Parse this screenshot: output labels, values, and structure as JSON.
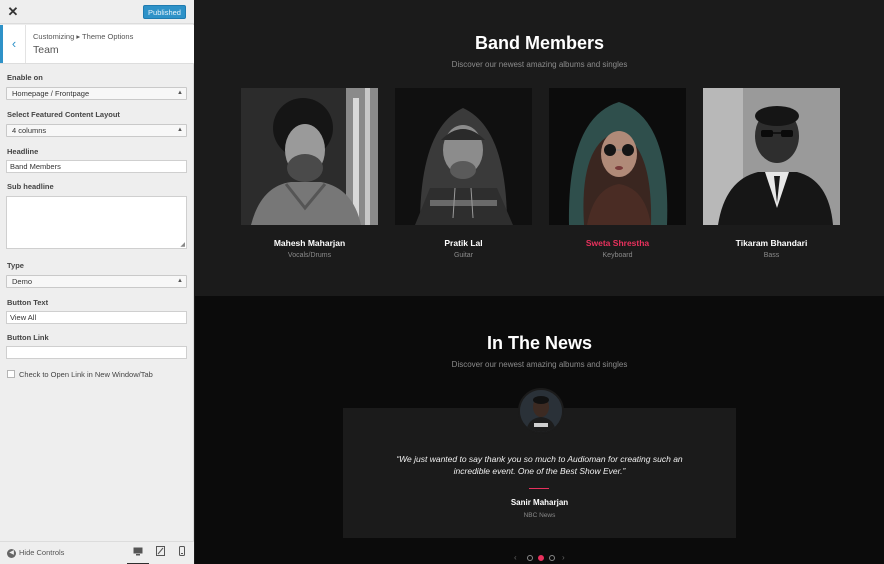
{
  "topbar": {
    "close_label": "✕",
    "published_label": "Published"
  },
  "section": {
    "breadcrumb": "Customizing ▸ Theme Options",
    "title": "Team",
    "back_glyph": "‹"
  },
  "controls": {
    "enable_on": {
      "label": "Enable on",
      "value": "Homepage / Frontpage"
    },
    "layout": {
      "label": "Select Featured Content Layout",
      "value": "4 columns"
    },
    "headline": {
      "label": "Headline",
      "value": "Band Members"
    },
    "subheadline": {
      "label": "Sub headline",
      "value": ""
    },
    "type": {
      "label": "Type",
      "value": "Demo"
    },
    "button_text": {
      "label": "Button Text",
      "value": "View All"
    },
    "button_link": {
      "label": "Button Link",
      "value": ""
    },
    "new_tab": {
      "label": "Check to Open Link in New Window/Tab",
      "checked": false
    }
  },
  "bottombar": {
    "hide_controls": "Hide Controls"
  },
  "band": {
    "title": "Band Members",
    "subtitle": "Discover our newest amazing albums and singles",
    "members": [
      {
        "name": "Mahesh Maharjan",
        "role": "Vocals/Drums"
      },
      {
        "name": "Pratik Lal",
        "role": "Guitar"
      },
      {
        "name": "Sweta Shrestha",
        "role": "Keyboard"
      },
      {
        "name": "Tikaram Bhandari",
        "role": "Bass"
      }
    ]
  },
  "news": {
    "title": "In The News",
    "subtitle": "Discover our newest amazing albums and singles",
    "quote": "“We just wanted to say thank you so much to Audioman for creating such an incredible event. One of the Best Show Ever.”",
    "author": "Sanir Maharjan",
    "source": "NBC News",
    "prev_glyph": "‹",
    "next_glyph": "›"
  },
  "colors": {
    "accent": "#e8315d",
    "wp_blue": "#2e92c8",
    "dark_bg": "#1b1b1b"
  }
}
